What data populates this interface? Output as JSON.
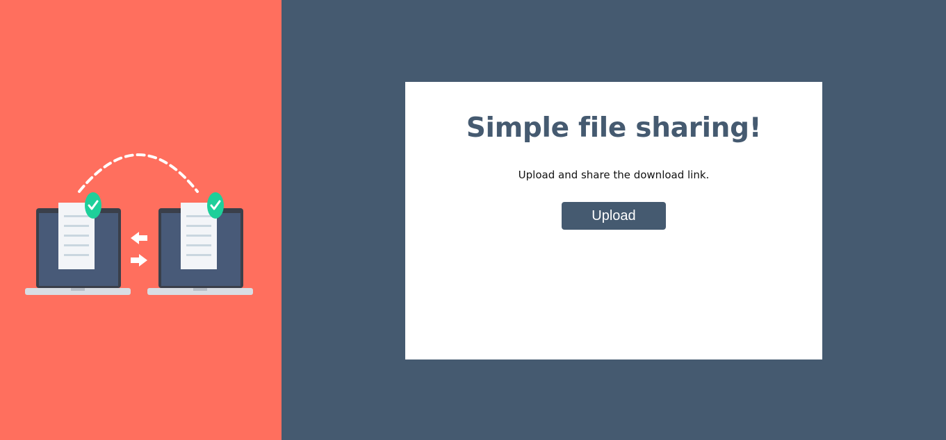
{
  "colors": {
    "left_background": "#ff6f5e",
    "right_background": "#455a70",
    "card_background": "#ffffff",
    "accent": "#455a70",
    "check_green": "#1ecf9a"
  },
  "illustration": {
    "icons": [
      "laptop-icon",
      "document-icon",
      "checkmark-icon",
      "arrow-left-icon",
      "arrow-right-icon",
      "laptop-icon",
      "document-icon",
      "checkmark-icon"
    ]
  },
  "card": {
    "title": "Simple file sharing!",
    "subtitle": "Upload and share the download link.",
    "upload_label": "Upload"
  }
}
